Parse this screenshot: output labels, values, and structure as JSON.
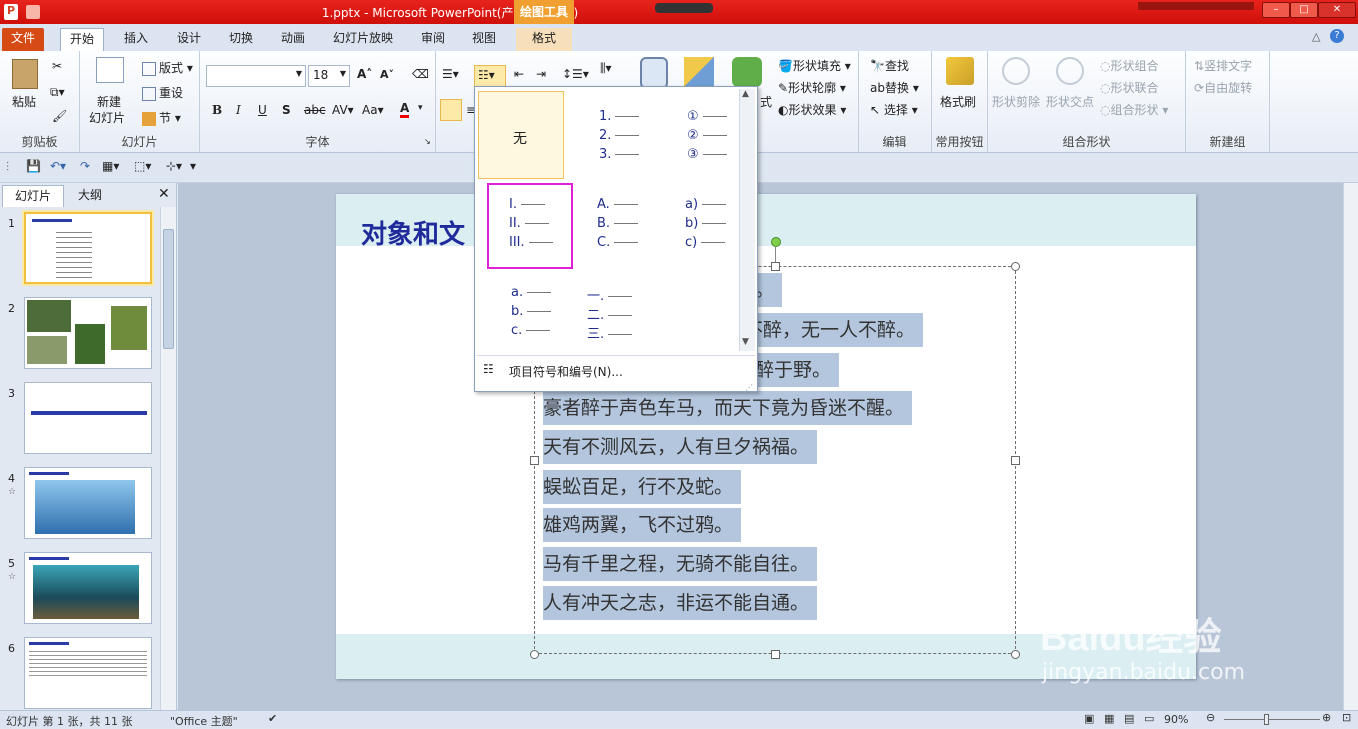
{
  "window": {
    "title": "1.pptx - Microsoft PowerPoint(产品激活失败)",
    "context_tab_group": "绘图工具"
  },
  "tabs": [
    "文件",
    "开始",
    "插入",
    "设计",
    "切换",
    "动画",
    "幻灯片放映",
    "审阅",
    "视图",
    "格式"
  ],
  "ribbon": {
    "clipboard": {
      "paste": "粘贴",
      "label": "剪贴板"
    },
    "slides": {
      "new_slide": "新建",
      "new_slide2": "幻灯片",
      "layout": "版式",
      "reset": "重设",
      "section": "节",
      "label": "幻灯片"
    },
    "font": {
      "size": "18",
      "label": "字体"
    },
    "drawing": {
      "shape_fill": "形状填充",
      "shape_outline": "形状轮廓",
      "shape_effect": "形状效果",
      "style_suffix": "式"
    },
    "editing": {
      "find": "查找",
      "replace": "替换",
      "select": "选择",
      "label": "编辑"
    },
    "common": {
      "format_painter": "格式刷",
      "label": "常用按钮"
    },
    "combine": {
      "shape_cut": "形状剪除",
      "shape_point": "形状交点",
      "shape_combine": "形状组合",
      "shape_union": "形状联合",
      "combine_shape": "组合形状",
      "label": "组合形状"
    },
    "newgroup": {
      "vertical_text": "竖排文字",
      "free_rotate": "自由旋转",
      "label": "新建组"
    }
  },
  "left_pane": {
    "tab_slides": "幻灯片",
    "tab_outline": "大纲",
    "slide_numbers": [
      "1",
      "2",
      "3",
      "4",
      "5",
      "6"
    ]
  },
  "slide": {
    "title": "对象和文",
    "lines": [
      "。",
      "日不醉，无一人不醉。",
      "醉于野。",
      "豪者醉于声色车马，而天下竟为昏迷不醒。",
      "天有不测风云，人有旦夕祸福。",
      "蜈蚣百足，行不及蛇。",
      "雄鸡两翼，飞不过鸦。",
      "马有千里之程，无骑不能自往。",
      "人有冲天之志，非运不能自通。"
    ]
  },
  "numbering_dropdown": {
    "none_label": "无",
    "options": [
      {
        "lines": [
          "1.",
          "2.",
          "3."
        ]
      },
      {
        "lines": [
          "①",
          "②",
          "③"
        ]
      },
      {
        "lines": [
          "I.",
          "II.",
          "III."
        ]
      },
      {
        "lines": [
          "A.",
          "B.",
          "C."
        ]
      },
      {
        "lines": [
          "a)",
          "b)",
          "c)"
        ]
      },
      {
        "lines": [
          "a.",
          "b.",
          "c."
        ]
      },
      {
        "lines": [
          "一.",
          "二.",
          "三."
        ]
      }
    ],
    "footer": "项目符号和编号(N)..."
  },
  "status": {
    "slide_info": "幻灯片 第 1 张，共 11 张",
    "theme": "\"Office 主题\"",
    "zoom": "90%"
  },
  "watermark": {
    "brand": "Baidu经验",
    "url": "jingyan.baidu.com"
  }
}
